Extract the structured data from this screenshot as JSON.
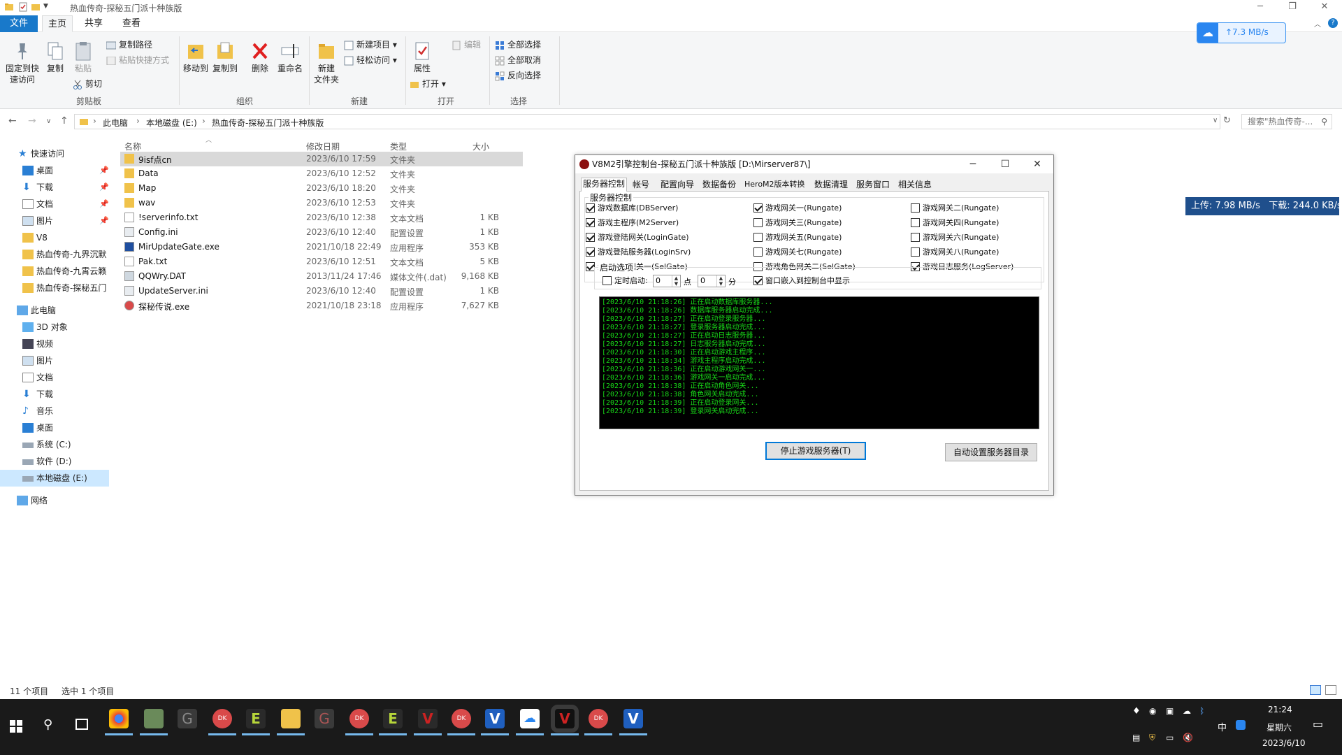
{
  "explorer": {
    "window_title": "热血传奇-探秘五门派十种族版",
    "ribbon_tabs": [
      "文件",
      "主页",
      "共享",
      "查看"
    ],
    "ribbon": {
      "pin_label_1": "固定到快",
      "pin_label_2": "速访问",
      "copy_label": "复制",
      "paste_label": "粘贴",
      "copy_path_label": "复制路径",
      "paste_shortcut_label": "粘贴快捷方式",
      "cut_label": "剪切",
      "clipboard_group": "剪贴板",
      "move_to_label": "移动到",
      "copy_to_label": "复制到",
      "delete_label": "删除",
      "rename_label": "重命名",
      "organize_group": "组织",
      "new_folder_label_1": "新建",
      "new_folder_label_2": "文件夹",
      "new_item_label": "新建项目 ▾",
      "easy_access_label": "轻松访问 ▾",
      "new_group": "新建",
      "properties_label": "属性",
      "open_label": "打开 ▾",
      "edit_label": "编辑",
      "open_group": "打开",
      "select_all_label": "全部选择",
      "select_none_label": "全部取消",
      "invert_selection_label": "反向选择",
      "select_group": "选择"
    },
    "address": {
      "crumbs": [
        "此电脑",
        "本地磁盘 (E:)",
        "热血传奇-探秘五门派十种族版"
      ],
      "search_placeholder": "搜索\"热血传奇-..."
    },
    "nav_pane": {
      "quick_access": "快速访问",
      "quick_items": [
        "桌面",
        "下载",
        "文档",
        "图片",
        "V8",
        "热血传奇-九界沉默",
        "热血传奇-九霄云籁",
        "热血传奇-探秘五门"
      ],
      "this_pc": "此电脑",
      "pc_items": [
        "3D 对象",
        "视频",
        "图片",
        "文档",
        "下载",
        "音乐",
        "桌面",
        "系统 (C:)",
        "软件 (D:)",
        "本地磁盘 (E:)"
      ],
      "network": "网络"
    },
    "columns": [
      "名称",
      "修改日期",
      "类型",
      "大小"
    ],
    "files": [
      {
        "name": "9isf点cn",
        "date": "2023/6/10 17:59",
        "type": "文件夹",
        "size": "",
        "icon": "folder-icon"
      },
      {
        "name": "Data",
        "date": "2023/6/10 12:52",
        "type": "文件夹",
        "size": "",
        "icon": "folder-icon"
      },
      {
        "name": "Map",
        "date": "2023/6/10 18:20",
        "type": "文件夹",
        "size": "",
        "icon": "folder-icon"
      },
      {
        "name": "wav",
        "date": "2023/6/10 12:53",
        "type": "文件夹",
        "size": "",
        "icon": "folder-icon"
      },
      {
        "name": "!serverinfo.txt",
        "date": "2023/6/10 12:38",
        "type": "文本文档",
        "size": "1 KB",
        "icon": "text-file-icon"
      },
      {
        "name": "Config.ini",
        "date": "2023/6/10 12:40",
        "type": "配置设置",
        "size": "1 KB",
        "icon": "config-file-icon"
      },
      {
        "name": "MirUpdateGate.exe",
        "date": "2021/10/18 22:49",
        "type": "应用程序",
        "size": "353 KB",
        "icon": "app-icon"
      },
      {
        "name": "Pak.txt",
        "date": "2023/6/10 12:51",
        "type": "文本文档",
        "size": "5 KB",
        "icon": "text-file-icon"
      },
      {
        "name": "QQWry.DAT",
        "date": "2013/11/24 17:46",
        "type": "媒体文件(.dat)",
        "size": "9,168 KB",
        "icon": "media-file-icon"
      },
      {
        "name": "UpdateServer.ini",
        "date": "2023/6/10 12:40",
        "type": "配置设置",
        "size": "1 KB",
        "icon": "config-file-icon"
      },
      {
        "name": "探秘传说.exe",
        "date": "2021/10/18 23:18",
        "type": "应用程序",
        "size": "7,627 KB",
        "icon": "game-app-icon"
      }
    ],
    "status": {
      "count": "11 个项目",
      "selected": "选中 1 个项目"
    }
  },
  "cloud_speed": "7.3 MB/s",
  "net_speed": {
    "up": "上传: 7.98 MB/s",
    "down": "下载: 244.0 KB/s"
  },
  "dialog": {
    "title": "V8M2引擎控制台-探秘五门派十种族版 [D:\\Mirserver87\\]",
    "tabs": [
      "服务器控制",
      "帐号",
      "配置向导",
      "数据备份",
      "HeroM2版本转换",
      "数据清理",
      "服务窗口",
      "相关信息"
    ],
    "server_control_label": "服务器控制",
    "services": [
      {
        "label": "游戏数据库(DBServer)",
        "checked": true
      },
      {
        "label": "游戏主程序(M2Server)",
        "checked": true
      },
      {
        "label": "游戏登陆网关(LoginGate)",
        "checked": true
      },
      {
        "label": "游戏登陆服务器(LoginSrv)",
        "checked": true
      },
      {
        "label": "游戏角色网关一(SelGate)",
        "checked": true
      },
      {
        "label": "游戏网关一(Rungate)",
        "checked": true
      },
      {
        "label": "游戏网关三(Rungate)",
        "checked": false
      },
      {
        "label": "游戏网关五(Rungate)",
        "checked": false
      },
      {
        "label": "游戏网关七(Rungate)",
        "checked": false
      },
      {
        "label": "游戏角色网关二(SelGate)",
        "checked": false
      },
      {
        "label": "游戏网关二(Rungate)",
        "checked": false
      },
      {
        "label": "游戏网关四(Rungate)",
        "checked": false
      },
      {
        "label": "游戏网关六(Rungate)",
        "checked": false
      },
      {
        "label": "游戏网关八(Rungate)",
        "checked": false
      },
      {
        "label": "游戏日志服务(LogServer)",
        "checked": true
      }
    ],
    "startup_label": "启动选项",
    "timed_start_label": "定时启动:",
    "timed_start_checked": false,
    "hour_value": "0",
    "hour_unit": "点",
    "minute_value": "0",
    "minute_unit": "分",
    "embed_label": "窗口嵌入到控制台中显示",
    "embed_checked": true,
    "log_lines": [
      "[2023/6/10 21:18:26] 正在启动数据库服务器...",
      "[2023/6/10 21:18:26] 数据库服务器启动完成...",
      "[2023/6/10 21:18:27] 正在启动登录服务器...",
      "[2023/6/10 21:18:27] 登录服务器启动完成...",
      "[2023/6/10 21:18:27] 正在启动日志服务器...",
      "[2023/6/10 21:18:27] 日志服务器启动完成...",
      "[2023/6/10 21:18:30] 正在启动游戏主程序...",
      "[2023/6/10 21:18:34] 游戏主程序启动完成...",
      "[2023/6/10 21:18:36] 正在启动游戏网关一...",
      "[2023/6/10 21:18:36] 游戏网关一启动完成...",
      "[2023/6/10 21:18:38] 正在启动角色网关...",
      "[2023/6/10 21:18:38] 角色网关启动完成...",
      "[2023/6/10 21:18:39] 正在启动登录网关...",
      "[2023/6/10 21:18:39] 登录网关启动完成..."
    ],
    "stop_button": "停止游戏服务器(T)",
    "auto_set_button": "自动设置服务器目录"
  },
  "taskbar": {
    "ime": "中",
    "time": "21:24",
    "weekday": "星期六",
    "date": "2023/6/10"
  },
  "colors": {
    "accent": "#1979ca",
    "selection": "#cce8ff",
    "console_text": "#18d818",
    "taskbar": "#1a1a1a"
  }
}
